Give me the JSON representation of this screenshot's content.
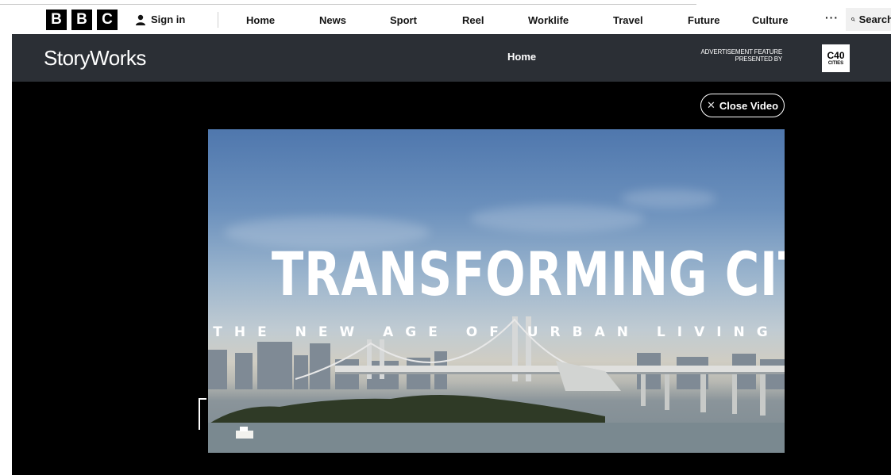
{
  "bbc_nav": {
    "logo_letters": [
      "B",
      "B",
      "C"
    ],
    "sign_in": "Sign in",
    "items": [
      {
        "label": "Home"
      },
      {
        "label": "News"
      },
      {
        "label": "Sport"
      },
      {
        "label": "Reel"
      },
      {
        "label": "Worklife"
      },
      {
        "label": "Travel"
      },
      {
        "label": "Future"
      },
      {
        "label": "Culture"
      }
    ],
    "more": "···",
    "search_label": "Search"
  },
  "storyworks": {
    "title": "StoryWorks",
    "home": "Home",
    "ad_feature_line1": "ADVERTISEMENT FEATURE",
    "ad_feature_line2": "PRESENTED BY",
    "partner_logo_main": "C40",
    "partner_logo_sub": "CITIES"
  },
  "video": {
    "close_label": "Close Video",
    "headline": "TRANSFORMING CITIES",
    "subheadline": "THE NEW AGE OF URBAN LIVING"
  },
  "colors": {
    "storyworks_bar": "#2b2f35",
    "video_background": "#000000"
  }
}
